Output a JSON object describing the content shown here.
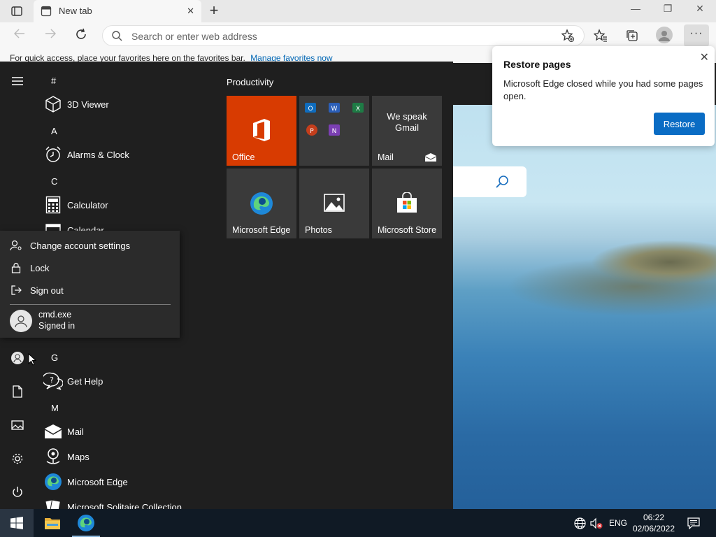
{
  "browser": {
    "tab_title": "New tab",
    "tab_close": "✕",
    "new_tab": "+",
    "window_controls": {
      "minimize": "—",
      "restore": "❐",
      "close": "✕"
    },
    "address_placeholder": "Search or enter web address",
    "more_label": "···",
    "favorites_bar": {
      "text": "For quick access, place your favorites here on the favorites bar.",
      "link": "Manage favorites now"
    }
  },
  "popup": {
    "title": "Restore pages",
    "body": "Microsoft Edge closed while you had some pages open.",
    "button": "Restore",
    "close": "✕"
  },
  "start_menu": {
    "letters": {
      "hash": "#",
      "a": "A",
      "c": "C",
      "g": "G",
      "m": "M"
    },
    "apps": {
      "viewer_3d": "3D Viewer",
      "alarms": "Alarms & Clock",
      "calculator": "Calculator",
      "calendar": "Calendar",
      "get_help": "Get Help",
      "mail": "Mail",
      "maps": "Maps",
      "edge": "Microsoft Edge",
      "solitaire": "Microsoft Solitaire Collection"
    },
    "tiles_header": "Productivity",
    "tiles": {
      "office": "Office",
      "mail_tile_text": "We speak Gmail",
      "mail": "Mail",
      "edge": "Microsoft Edge",
      "photos": "Photos",
      "store": "Microsoft Store"
    },
    "account_flyout": {
      "change_settings": "Change account settings",
      "lock": "Lock",
      "sign_out": "Sign out",
      "user_name": "cmd.exe",
      "user_status": "Signed in"
    }
  },
  "taskbar": {
    "language": "ENG",
    "time": "06:22",
    "date": "02/06/2022"
  },
  "colors": {
    "office_tile": "#d83b01",
    "restore_button": "#0a6cc4",
    "start_bg": "#1f1f1f",
    "taskbar_bg": "#101a25"
  }
}
